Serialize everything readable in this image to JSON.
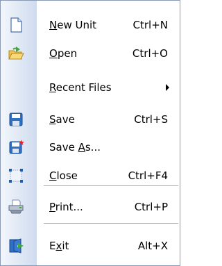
{
  "menu": {
    "items": [
      {
        "pre": "",
        "mnemonic": "N",
        "post": "ew Unit",
        "shortcut": "Ctrl+N",
        "icon": "new-document-icon"
      },
      {
        "pre": "",
        "mnemonic": "O",
        "post": "pen",
        "shortcut": "Ctrl+O",
        "icon": "open-folder-icon"
      },
      {
        "pre": "",
        "mnemonic": "R",
        "post": "ecent Files",
        "shortcut": "",
        "icon": "",
        "submenu": true
      },
      {
        "pre": "",
        "mnemonic": "S",
        "post": "ave",
        "shortcut": "Ctrl+S",
        "icon": "save-icon"
      },
      {
        "pre": "Save ",
        "mnemonic": "A",
        "post": "s...",
        "shortcut": "",
        "icon": "save-as-icon"
      },
      {
        "pre": "",
        "mnemonic": "C",
        "post": "lose",
        "shortcut": "Ctrl+F4",
        "icon": "close-icon"
      },
      {
        "pre": "",
        "mnemonic": "P",
        "post": "rint...",
        "shortcut": "Ctrl+P",
        "icon": "printer-icon"
      },
      {
        "pre": "E",
        "mnemonic": "x",
        "post": "it",
        "shortcut": "Alt+X",
        "icon": "exit-icon"
      }
    ]
  },
  "colors": {
    "accent": "#1f5bb0",
    "gutter_light": "#f3f7fc",
    "gutter_dark": "#cfdbee",
    "border": "#8a99b3"
  }
}
